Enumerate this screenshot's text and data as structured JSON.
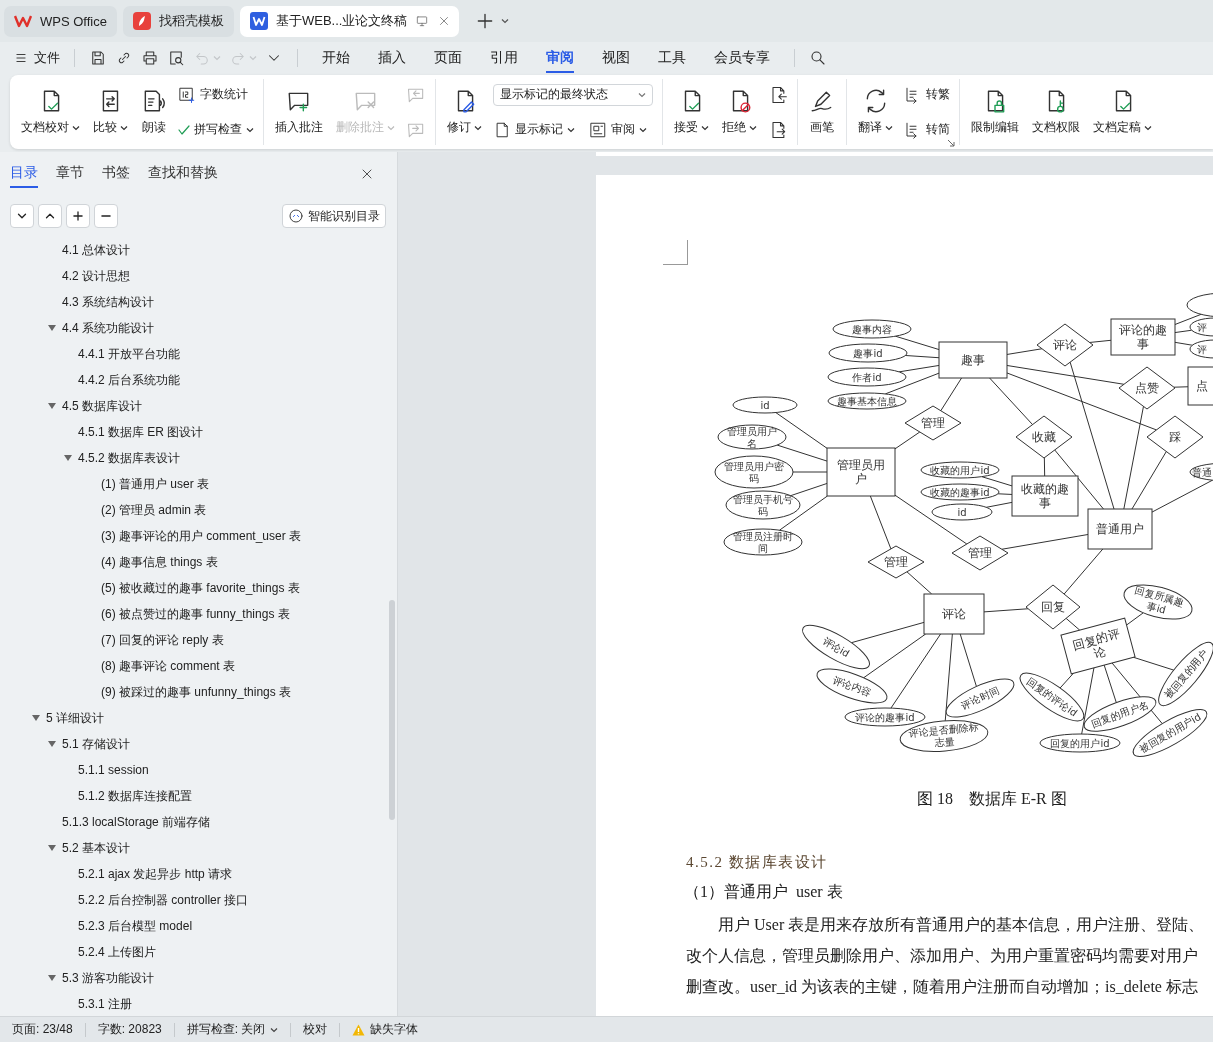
{
  "app_tabs": [
    {
      "kind": "home",
      "label": "WPS Office",
      "selected": false
    },
    {
      "kind": "template",
      "label": "找稻壳模板",
      "selected": false
    },
    {
      "kind": "document",
      "label": "基于WEB...业论文终稿",
      "selected": true
    }
  ],
  "menu": {
    "file": "文件",
    "quick_access": [
      {
        "disabled": false
      },
      {
        "disabled": false
      },
      {
        "disabled": false
      },
      {
        "disabled": false
      },
      {
        "disabled": true,
        "caret": true
      },
      {
        "disabled": true,
        "caret": true
      },
      {
        "disabled": false
      }
    ],
    "tabs": [
      {
        "label": "开始",
        "selected": false
      },
      {
        "label": "插入",
        "selected": false
      },
      {
        "label": "页面",
        "selected": false
      },
      {
        "label": "引用",
        "selected": false
      },
      {
        "label": "审阅",
        "selected": true
      },
      {
        "label": "视图",
        "selected": false
      },
      {
        "label": "工具",
        "selected": false
      },
      {
        "label": "会员专享",
        "selected": false
      }
    ]
  },
  "ribbon": {
    "groups": [
      {
        "columns": [
          [
            {
              "kind": "big",
              "label": "文档校对",
              "caret": true,
              "disabled": false
            }
          ],
          [
            {
              "kind": "big",
              "label": "比较",
              "caret": true,
              "disabled": false
            }
          ],
          [
            {
              "kind": "big",
              "label": "朗读",
              "disabled": false
            }
          ],
          [
            {
              "kind": "small",
              "label": "字数统计",
              "disabled": false
            },
            {
              "kind": "small",
              "label": "拼写检查",
              "caret": true,
              "disabled": false
            }
          ]
        ]
      },
      {
        "columns": [
          [
            {
              "kind": "big",
              "label": "插入批注",
              "disabled": false
            }
          ],
          [
            {
              "kind": "big",
              "label": "删除批注",
              "caret": true,
              "disabled": true
            }
          ],
          [
            {
              "kind": "icon",
              "disabled": true
            },
            {
              "kind": "icon",
              "disabled": true
            }
          ]
        ]
      },
      {
        "columns": [
          [
            {
              "kind": "big",
              "label": "修订",
              "caret": true,
              "disabled": false
            }
          ],
          [
            {
              "kind": "select",
              "value": "显示标记的最终状态"
            },
            {
              "kind": "pair",
              "items": [
                {
                  "kind": "small",
                  "label": "显示标记",
                  "caret": true,
                  "disabled": false
                },
                {
                  "kind": "small",
                  "label": "审阅",
                  "caret": true,
                  "disabled": false
                }
              ]
            }
          ]
        ]
      },
      {
        "columns": [
          [
            {
              "kind": "big",
              "label": "接受",
              "caret": true,
              "disabled": false
            }
          ],
          [
            {
              "kind": "big",
              "label": "拒绝",
              "caret": true,
              "disabled": false
            }
          ],
          [
            {
              "kind": "icon",
              "disabled": false
            },
            {
              "kind": "icon",
              "disabled": false
            }
          ]
        ]
      },
      {
        "columns": [
          [
            {
              "kind": "big",
              "label": "画笔",
              "disabled": false
            }
          ]
        ]
      },
      {
        "launcher": true,
        "columns": [
          [
            {
              "kind": "big",
              "label": "翻译",
              "caret": true,
              "disabled": false
            }
          ],
          [
            {
              "kind": "small",
              "label": "转繁",
              "disabled": false
            },
            {
              "kind": "small",
              "label": "转简",
              "disabled": false
            }
          ]
        ]
      },
      {
        "columns": [
          [
            {
              "kind": "big",
              "label": "限制编辑",
              "disabled": false
            }
          ],
          [
            {
              "kind": "big",
              "label": "文档权限",
              "disabled": false
            }
          ],
          [
            {
              "kind": "big",
              "label": "文档定稿",
              "caret": true,
              "disabled": false
            }
          ]
        ]
      }
    ]
  },
  "sidebar": {
    "tabs": [
      {
        "label": "目录",
        "selected": true
      },
      {
        "label": "章节",
        "selected": false
      },
      {
        "label": "书签",
        "selected": false
      },
      {
        "label": "查找和替换",
        "selected": false
      }
    ],
    "smart_button": "智能识别目录",
    "toc": [
      {
        "children": [
          {
            "label": "4.1 总体设计"
          },
          {
            "label": "4.2 设计思想"
          },
          {
            "label": "4.3 系统结构设计"
          },
          {
            "label": "4.4 系统功能设计",
            "expanded": true,
            "children": [
              {
                "label": "4.4.1 开放平台功能"
              },
              {
                "label": "4.4.2 后台系统功能"
              }
            ]
          },
          {
            "label": "4.5 数据库设计",
            "expanded": true,
            "children": [
              {
                "label": "4.5.1 数据库 ER 图设计"
              },
              {
                "label": "4.5.2 数据库表设计",
                "expanded": true,
                "children": [
                  {
                    "label": "(1) 普通用户 user 表"
                  },
                  {
                    "label": "(2) 管理员 admin 表"
                  },
                  {
                    "label": "(3) 趣事评论的用户 comment_user 表"
                  },
                  {
                    "label": "(4) 趣事信息 things 表"
                  },
                  {
                    "label": "(5) 被收藏过的趣事 favorite_things 表"
                  },
                  {
                    "label": "(6) 被点赞过的趣事 funny_things 表"
                  },
                  {
                    "label": "(7) 回复的评论 reply 表"
                  },
                  {
                    "label": "(8) 趣事评论 comment 表"
                  },
                  {
                    "label": "(9) 被踩过的趣事 unfunny_things 表"
                  }
                ]
              }
            ]
          }
        ]
      },
      {
        "label": "5 详细设计",
        "expanded": true,
        "children": [
          {
            "label": "5.1 存储设计",
            "expanded": true,
            "children": [
              {
                "label": "5.1.1 session"
              },
              {
                "label": "5.1.2 数据库连接配置"
              }
            ]
          },
          {
            "label": "5.1.3 localStorage 前端存储"
          },
          {
            "label": "5.2 基本设计",
            "expanded": true,
            "children": [
              {
                "label": "5.2.1 ajax 发起异步 http 请求"
              },
              {
                "label": "5.2.2 后台控制器 controller 接口"
              },
              {
                "label": "5.2.3 后台模型 model"
              },
              {
                "label": "5.2.4 上传图片"
              }
            ]
          },
          {
            "label": "5.3 游客功能设计",
            "expanded": true,
            "children": [
              {
                "label": "5.3.1 注册"
              }
            ]
          }
        ]
      }
    ]
  },
  "document": {
    "diagram": {
      "nodes": [
        {
          "kind": "entity",
          "label": "趣事"
        },
        {
          "kind": "entity",
          "label": "评论的趣事"
        },
        {
          "kind": "entity",
          "label": "点"
        },
        {
          "kind": "entity",
          "label": "管理员用户"
        },
        {
          "kind": "entity",
          "label": "收藏的趣事"
        },
        {
          "kind": "entity",
          "label": "普通用户"
        },
        {
          "kind": "entity",
          "label": "评论"
        },
        {
          "kind": "entity",
          "label": "回复的评论"
        },
        {
          "kind": "relation",
          "label": "评论"
        },
        {
          "kind": "relation",
          "label": "点赞"
        },
        {
          "kind": "relation",
          "label": "管理"
        },
        {
          "kind": "relation",
          "label": "收藏"
        },
        {
          "kind": "relation",
          "label": "踩"
        },
        {
          "kind": "relation",
          "label": "管理"
        },
        {
          "kind": "relation",
          "label": "管理"
        },
        {
          "kind": "relation",
          "label": "回复"
        },
        {
          "kind": "attribute",
          "label": "趣事内容"
        },
        {
          "kind": "attribute",
          "label": "趣事id"
        },
        {
          "kind": "attribute",
          "label": "作者id"
        },
        {
          "kind": "attribute",
          "label": "趣事基本信息"
        },
        {
          "kind": "attribute",
          "label": "id"
        },
        {
          "kind": "attribute",
          "label": "管理员用户名"
        },
        {
          "kind": "attribute",
          "label": "管理员用户密码"
        },
        {
          "kind": "attribute",
          "label": "管理员手机号码"
        },
        {
          "kind": "attribute",
          "label": "管理员注册时间"
        },
        {
          "kind": "attribute",
          "label": "收藏的用户id"
        },
        {
          "kind": "attribute",
          "label": "收藏的趣事id"
        },
        {
          "kind": "attribute",
          "label": "id"
        },
        {
          "kind": "attribute",
          "label": "评论id"
        },
        {
          "kind": "attribute",
          "label": "评论内容"
        },
        {
          "kind": "attribute",
          "label": "评论的趣事id"
        },
        {
          "kind": "attribute",
          "label": "评论是否删除标志量"
        },
        {
          "kind": "attribute",
          "label": "评论时间"
        },
        {
          "kind": "attribute",
          "label": "回复所属趣事id"
        },
        {
          "kind": "attribute",
          "label": "回复的评论id"
        },
        {
          "kind": "attribute",
          "label": "回复的用户名"
        },
        {
          "kind": "attribute",
          "label": "回复的用户id"
        },
        {
          "kind": "attribute",
          "label": "被回复的用户"
        },
        {
          "kind": "attribute",
          "label": "被回复的用户id"
        },
        {
          "kind": "attribute",
          "label": "评"
        },
        {
          "kind": "attribute",
          "label": "评"
        },
        {
          "kind": "attribute",
          "label": "普通"
        },
        {
          "kind": "attribute"
        }
      ]
    },
    "caption": "图 18　数据库 E-R 图",
    "heading": "4.5.2 数据库表设计",
    "subheading": "（1）普通用户  user 表",
    "paragraph": {
      "lines": [
        "用户 User 表是用来存放所有普通用户的基本信息，用户注册、登陆、",
        "改个人信息，管理员删除用户、添加用户、为用户重置密码均需要对用户",
        "删查改。user_id 为该表的主键，随着用户注册而自动增加；is_delete 标志"
      ]
    }
  },
  "status_bar": {
    "items": [
      {
        "label": "页面: 23/48"
      },
      {
        "label": "字数: 20823"
      },
      {
        "label": "拼写检查: 关闭",
        "caret": true
      },
      {
        "label": "校对"
      },
      {
        "label": "缺失字体",
        "warning": true
      }
    ]
  }
}
